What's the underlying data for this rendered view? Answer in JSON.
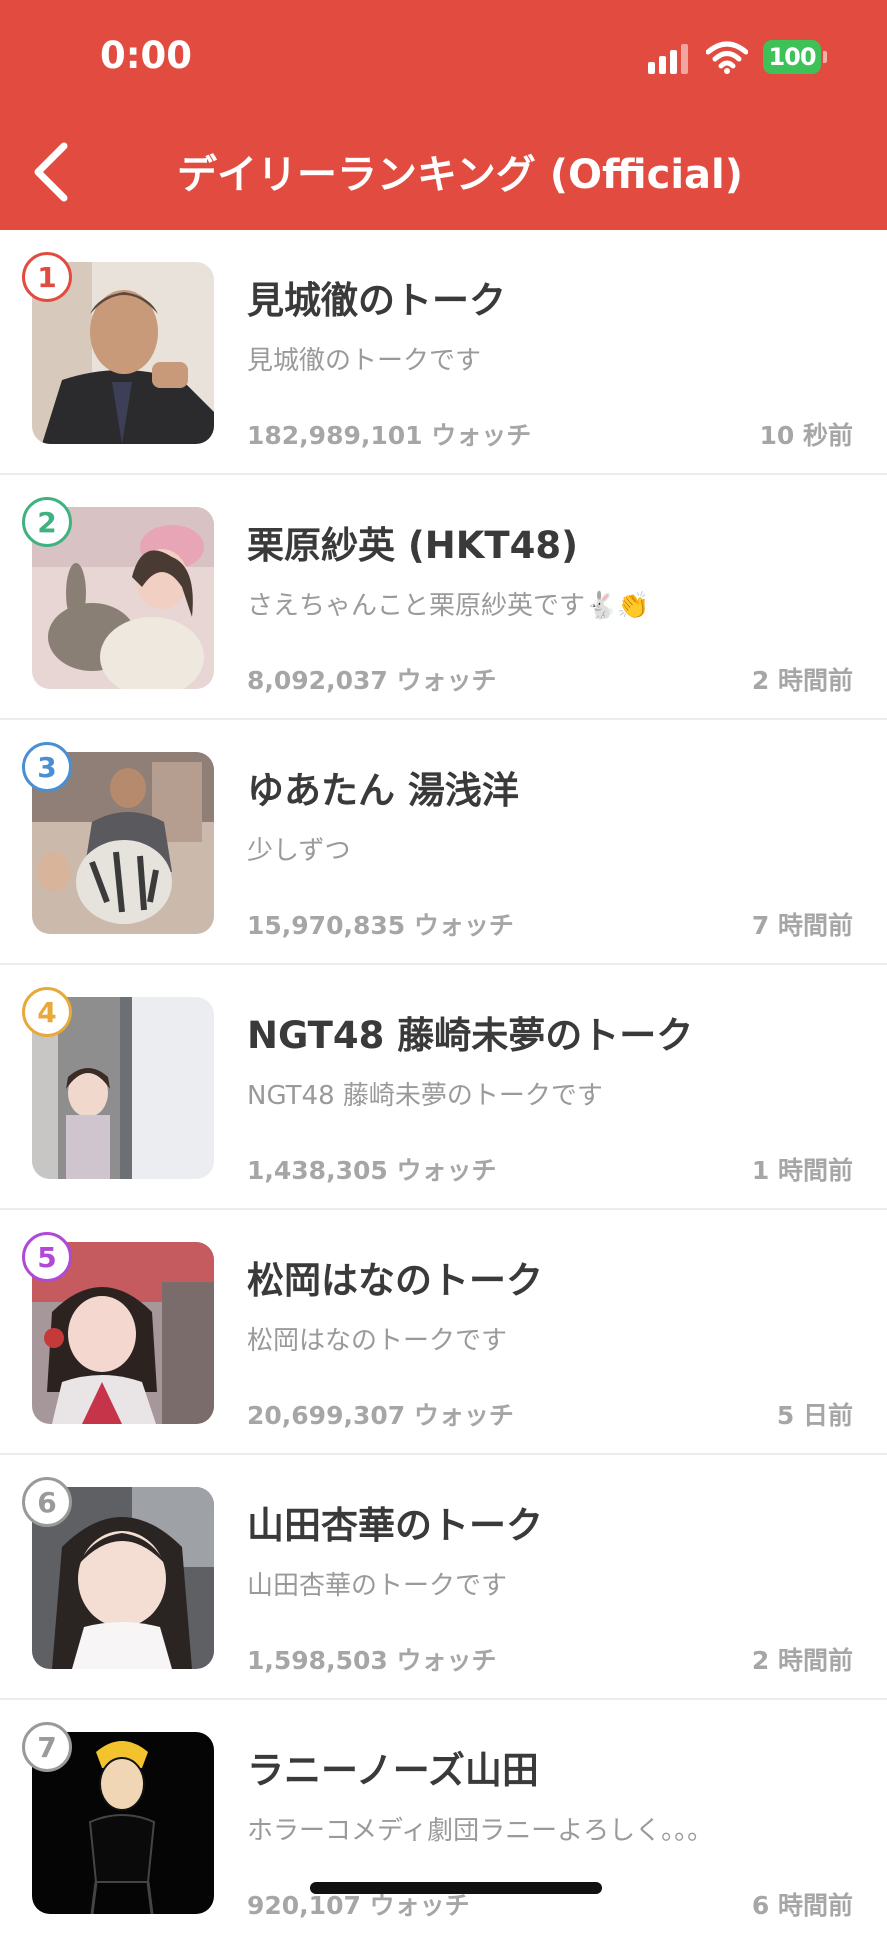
{
  "status_bar": {
    "time": "0:00",
    "battery": "100"
  },
  "header": {
    "title": "デイリーランキング (Official)"
  },
  "colors": {
    "header_bg": "#e24b3f",
    "battery": "#3fc15a"
  },
  "rankings": [
    {
      "rank": "1",
      "rank_color": "#e24b3f",
      "name": "見城徹のトーク",
      "description": "見城徹のトークです",
      "watch": "182,989,101 ウォッチ",
      "time": "10 秒前"
    },
    {
      "rank": "2",
      "rank_color": "#3fb27f",
      "name": "栗原紗英 (HKT48)",
      "description": "さえちゃんこと栗原紗英です🐇👏",
      "watch": "8,092,037 ウォッチ",
      "time": "2 時間前"
    },
    {
      "rank": "3",
      "rank_color": "#4a8fd6",
      "name": "ゆあたん 湯浅洋",
      "description": "少しずつ",
      "watch": "15,970,835 ウォッチ",
      "time": "7 時間前"
    },
    {
      "rank": "4",
      "rank_color": "#e8a83a",
      "name": "NGT48 藤崎未夢のトーク",
      "description": "NGT48 藤崎未夢のトークです",
      "watch": "1,438,305 ウォッチ",
      "time": "1 時間前"
    },
    {
      "rank": "5",
      "rank_color": "#b04ad6",
      "name": "松岡はなのトーク",
      "description": "松岡はなのトークです",
      "watch": "20,699,307 ウォッチ",
      "time": "5 日前"
    },
    {
      "rank": "6",
      "rank_color": "#9a9a9a",
      "name": "山田杏華のトーク",
      "description": "山田杏華のトークです",
      "watch": "1,598,503 ウォッチ",
      "time": "2 時間前"
    },
    {
      "rank": "7",
      "rank_color": "#9a9a9a",
      "name": "ラニーノーズ山田",
      "description": "ホラーコメディ劇団ラニーよろしく。。。",
      "watch": "920,107 ウォッチ",
      "time": "6 時間前"
    }
  ]
}
